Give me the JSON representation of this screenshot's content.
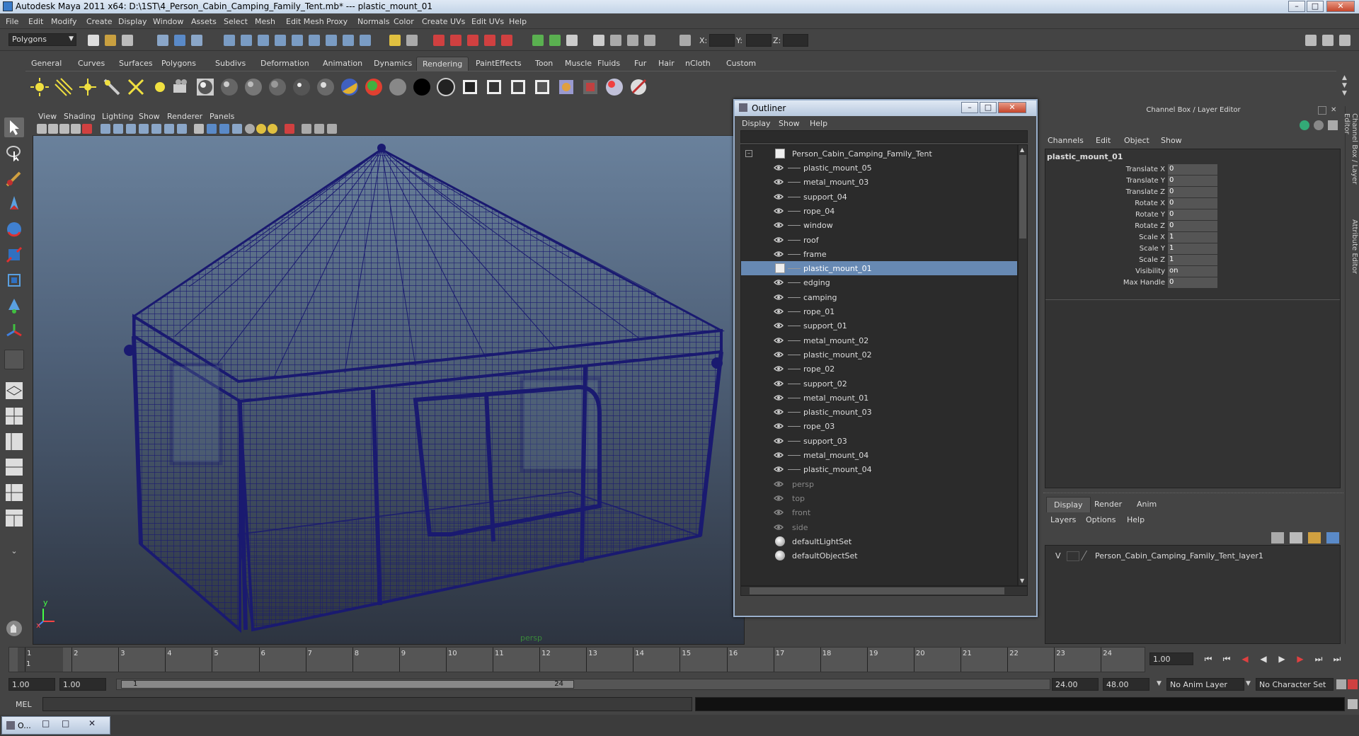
{
  "window": {
    "title": "Autodesk Maya 2011 x64: D:\\1ST\\4_Person_Cabin_Camping_Family_Tent.mb*   ---   plastic_mount_01"
  },
  "menubar": [
    "File",
    "Edit",
    "Modify",
    "Create",
    "Display",
    "Window",
    "Assets",
    "Select",
    "Mesh",
    "Edit Mesh",
    "Proxy",
    "Normals",
    "Color",
    "Create UVs",
    "Edit UVs",
    "Help"
  ],
  "statusline": {
    "mode": "Polygons",
    "x_label": "X:",
    "y_label": "Y:",
    "z_label": "Z:"
  },
  "shelf_tabs": [
    "General",
    "Curves",
    "Surfaces",
    "Polygons",
    "Subdivs",
    "Deformation",
    "Animation",
    "Dynamics",
    "Rendering",
    "PaintEffects",
    "Toon",
    "Muscle",
    "Fluids",
    "Fur",
    "Hair",
    "nCloth",
    "Custom"
  ],
  "active_shelf_tab": "Rendering",
  "viewport": {
    "menu": [
      "View",
      "Shading",
      "Lighting",
      "Show",
      "Renderer",
      "Panels"
    ],
    "camera_label": "persp",
    "axis_y": "y",
    "axis_x": "x",
    "wire_color": "#1a1a70"
  },
  "outliner": {
    "title": "Outliner",
    "menu": [
      "Display",
      "Show",
      "Help"
    ],
    "root": "Person_Cabin_Camping_Family_Tent",
    "children": [
      "plastic_mount_05",
      "metal_mount_03",
      "support_04",
      "rope_04",
      "window",
      "roof",
      "frame",
      "plastic_mount_01",
      "edging",
      "camping",
      "rope_01",
      "support_01",
      "metal_mount_02",
      "plastic_mount_02",
      "rope_02",
      "support_02",
      "metal_mount_01",
      "plastic_mount_03",
      "rope_03",
      "support_03",
      "metal_mount_04",
      "plastic_mount_04"
    ],
    "selected": "plastic_mount_01",
    "cameras": [
      "persp",
      "top",
      "front",
      "side"
    ],
    "sets": [
      "defaultLightSet",
      "defaultObjectSet"
    ]
  },
  "channel_box": {
    "title": "Channel Box / Layer Editor",
    "menu": [
      "Channels",
      "Edit",
      "Object",
      "Show"
    ],
    "object": "plastic_mount_01",
    "attributes": [
      {
        "name": "Translate X",
        "value": "0"
      },
      {
        "name": "Translate Y",
        "value": "0"
      },
      {
        "name": "Translate Z",
        "value": "0"
      },
      {
        "name": "Rotate X",
        "value": "0"
      },
      {
        "name": "Rotate Y",
        "value": "0"
      },
      {
        "name": "Rotate Z",
        "value": "0"
      },
      {
        "name": "Scale X",
        "value": "1"
      },
      {
        "name": "Scale Y",
        "value": "1"
      },
      {
        "name": "Scale Z",
        "value": "1"
      },
      {
        "name": "Visibility",
        "value": "on"
      },
      {
        "name": "Max Handle",
        "value": "0"
      }
    ],
    "side_tabs": [
      "Channel Box / Layer Editor",
      "Attribute Editor"
    ]
  },
  "layer_editor": {
    "tabs": [
      "Display",
      "Render",
      "Anim"
    ],
    "menu": [
      "Layers",
      "Options",
      "Help"
    ],
    "layer_visible": "V",
    "layer_name": "Person_Cabin_Camping_Family_Tent_layer1"
  },
  "time_slider": {
    "ticks": [
      "1",
      "2",
      "3",
      "4",
      "5",
      "6",
      "7",
      "8",
      "9",
      "10",
      "11",
      "12",
      "13",
      "14",
      "15",
      "16",
      "17",
      "18",
      "19",
      "20",
      "21",
      "22",
      "23",
      "24"
    ],
    "current_frame_marker": "1",
    "current_time": "1.00"
  },
  "range_slider": {
    "start": "1.00",
    "anim_start": "1.00",
    "range_start_label": "1",
    "range_end_label": "24",
    "playback_end": "24.00",
    "anim_end": "48.00",
    "anim_layer": "No Anim Layer",
    "character_set": "No Character Set"
  },
  "command_line": {
    "label": "MEL"
  },
  "taskbar": {
    "item": "O..."
  }
}
